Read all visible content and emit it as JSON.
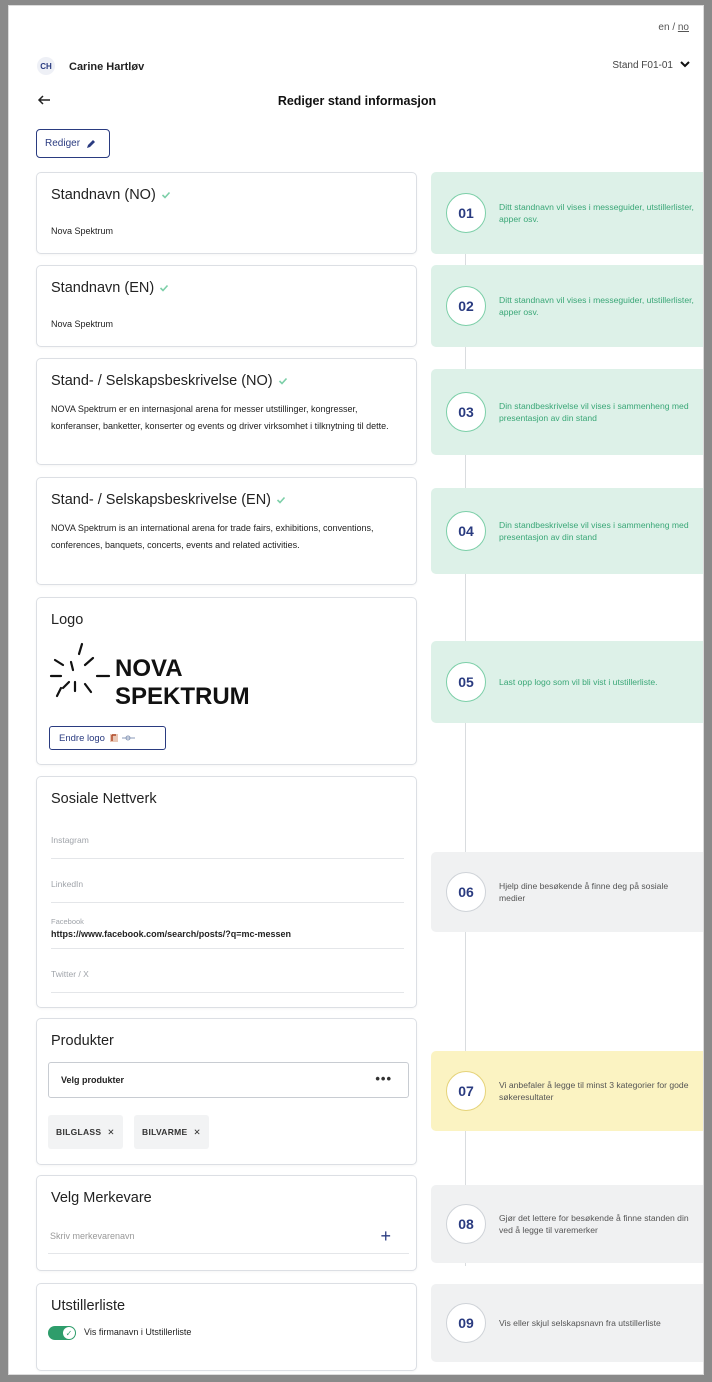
{
  "language": {
    "en": "en",
    "separator": "/",
    "no": "no"
  },
  "user": {
    "initials": "CH",
    "name": "Carine Hartløv"
  },
  "stand_selector": {
    "label": "Stand F01-01"
  },
  "page_title": "Rediger stand informasjon",
  "edit_button": {
    "label": "Rediger"
  },
  "sections": {
    "standname_no": {
      "title": "Standnavn (NO)",
      "value": "Nova Spektrum"
    },
    "standname_en": {
      "title": "Standnavn (EN)",
      "value": "Nova Spektrum"
    },
    "desc_no": {
      "title": "Stand- / Selskapsbeskrivelse (NO)",
      "value": "NOVA Spektrum er en internasjonal arena for messer utstillinger, kongresser, konferanser, banketter, konserter og events og driver virksomhet i tilknytning til dette."
    },
    "desc_en": {
      "title": "Stand- / Selskapsbeskrivelse (EN)",
      "value": "NOVA Spektrum is an international arena for trade fairs, exhibitions, conventions, conferences, banquets, concerts, events and related activities."
    },
    "logo": {
      "title": "Logo",
      "logo_line1": "NOVA",
      "logo_line2": "SPEKTRUM",
      "change_button": "Endre logo"
    },
    "social": {
      "title": "Sosiale Nettverk",
      "instagram_label": "Instagram",
      "linkedin_label": "LinkedIn",
      "facebook_label": "Facebook",
      "facebook_value": "https://www.facebook.com/search/posts/?q=mc-messen",
      "twitter_label": "Twitter / X"
    },
    "products": {
      "title": "Produkter",
      "select_label": "Velg produkter",
      "more": "•••",
      "chips": [
        "BILGLASS",
        "BILVARME"
      ]
    },
    "brands": {
      "title": "Velg Merkevare",
      "placeholder": "Skriv merkevarenavn",
      "add": "+"
    },
    "exhibitor_list": {
      "title": "Utstillerliste",
      "toggle_label": "Vis firmanavn i Utstillerliste",
      "toggle_on": true
    }
  },
  "steps": [
    {
      "num": "01",
      "text": "Ditt standnavn vil vises i messeguider, utstillerlister, apper osv."
    },
    {
      "num": "02",
      "text": "Ditt standnavn vil vises i messeguider, utstillerlister, apper osv."
    },
    {
      "num": "03",
      "text": "Din standbeskrivelse vil vises i sammenheng med presentasjon av din stand"
    },
    {
      "num": "04",
      "text": "Din standbeskrivelse vil vises i sammenheng med presentasjon av din stand"
    },
    {
      "num": "05",
      "text": "Last opp logo som vil bli vist i utstillerliste."
    },
    {
      "num": "06",
      "text": "Hjelp dine besøkende å finne deg på sosiale medier"
    },
    {
      "num": "07",
      "text": "Vi anbefaler å legge til minst 3 kategorier for gode søkeresultater"
    },
    {
      "num": "08",
      "text": "Gjør det lettere for besøkende å finne standen din ved å legge til varemerker"
    },
    {
      "num": "09",
      "text": "Vis eller skjul selskapsnavn fra utstillerliste"
    }
  ],
  "colors": {
    "navy": "#2a3b80",
    "green_panel": "#ddf1e8",
    "green_text": "#3aa777",
    "yellow_panel": "#fbf3c2",
    "grey_panel": "#f0f1f2",
    "toggle_on": "#2e9d6b"
  }
}
